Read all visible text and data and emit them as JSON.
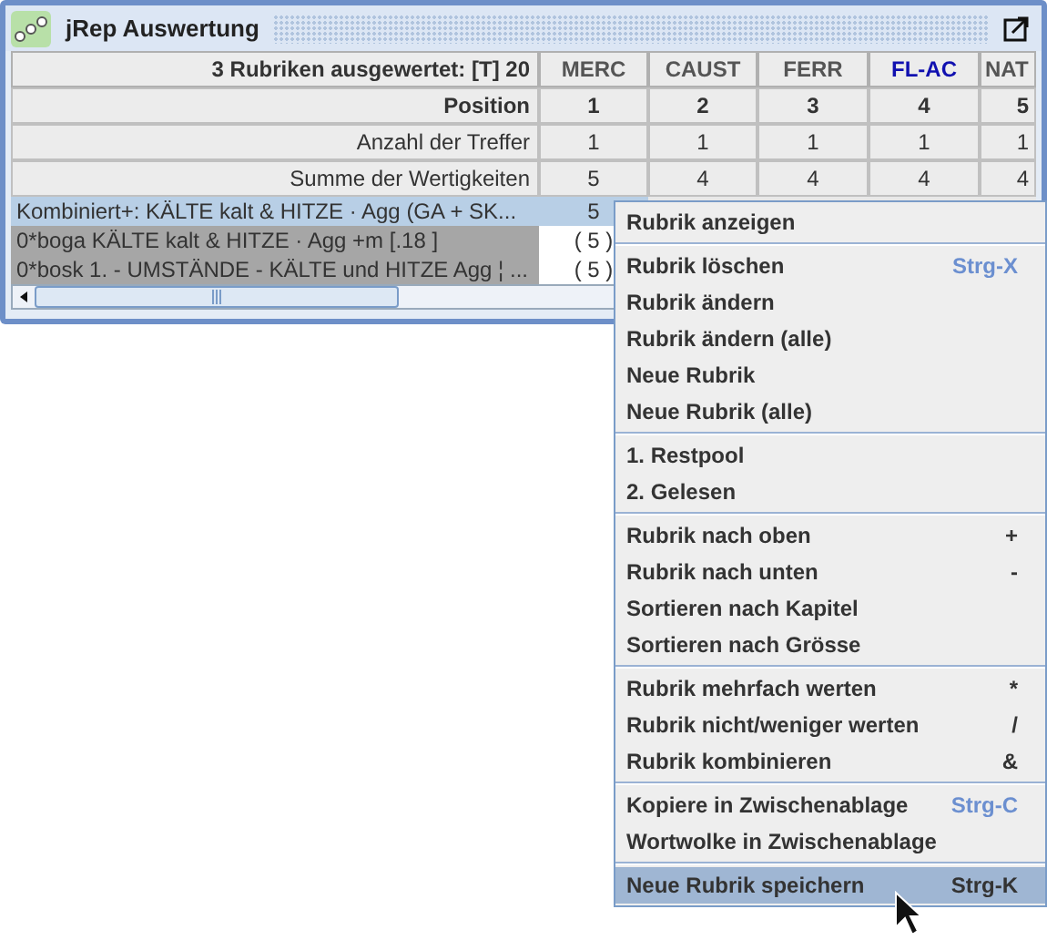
{
  "window": {
    "title": "jRep Auswertung"
  },
  "table": {
    "header": {
      "label": "3 Rubriken ausgewertet:  [T] 20",
      "columns": [
        {
          "name": "MERC",
          "color": "#555555"
        },
        {
          "name": "CAUST",
          "color": "#555555"
        },
        {
          "name": "FERR",
          "color": "#555555"
        },
        {
          "name": "FL-AC",
          "color": "#1010b0"
        },
        {
          "name": "NAT",
          "color": "#555555"
        }
      ]
    },
    "summary_rows": [
      {
        "kind": "bold",
        "label": "Position",
        "values": [
          "1",
          "2",
          "3",
          "4",
          "5"
        ]
      },
      {
        "kind": "plain",
        "label": "Anzahl der Treffer",
        "values": [
          "1",
          "1",
          "1",
          "1",
          "1"
        ]
      },
      {
        "kind": "plain",
        "label": "Summe der Wertigkeiten",
        "values": [
          "5",
          "4",
          "4",
          "4",
          "4"
        ]
      }
    ],
    "rubric_rows": [
      {
        "label": "Kombiniert+:  KÄLTE kalt & HITZE · Agg  (GA + SK...",
        "value": "5",
        "selected": true
      },
      {
        "label": "0*boga  KÄLTE kalt & HITZE · Agg  +m  [.18 ]",
        "value": "( 5 )",
        "selected": false
      },
      {
        "label": "0*bosk  1. - UMSTÄNDE - KÄLTE und HITZE Agg ¦ ...",
        "value": "( 5 )",
        "selected": false
      }
    ]
  },
  "context_menu": {
    "groups": [
      {
        "items": [
          {
            "label": "Rubrik anzeigen",
            "selected": false
          }
        ]
      },
      {
        "items": [
          {
            "label": "Rubrik löschen",
            "shortcut": "Strg-X",
            "color": "#6b8fd0",
            "selected": false
          },
          {
            "label": "Rubrik ändern",
            "selected": false
          },
          {
            "label": "Rubrik ändern (alle)",
            "selected": false
          },
          {
            "label": "Neue Rubrik",
            "selected": false
          },
          {
            "label": "Neue Rubrik (alle)",
            "selected": false
          }
        ]
      },
      {
        "items": [
          {
            "label": "1. Restpool",
            "selected": false
          },
          {
            "label": "2. Gelesen",
            "selected": false
          }
        ]
      },
      {
        "items": [
          {
            "label": "Rubrik nach oben",
            "shortcut": "+",
            "color": "#333333",
            "selected": false
          },
          {
            "label": "Rubrik nach unten",
            "shortcut": "-",
            "color": "#333333",
            "selected": false
          },
          {
            "label": "Sortieren nach Kapitel",
            "selected": false
          },
          {
            "label": "Sortieren nach Grösse",
            "selected": false
          }
        ]
      },
      {
        "items": [
          {
            "label": "Rubrik mehrfach werten",
            "shortcut": "*",
            "color": "#333333",
            "selected": false
          },
          {
            "label": "Rubrik nicht/weniger werten",
            "shortcut": "/",
            "color": "#333333",
            "selected": false
          },
          {
            "label": "Rubrik kombinieren",
            "shortcut": "&",
            "color": "#333333",
            "selected": false
          }
        ]
      },
      {
        "items": [
          {
            "label": "Kopiere in Zwischenablage",
            "shortcut": "Strg-C",
            "color": "#6b8fd0",
            "selected": false
          },
          {
            "label": "Wortwolke in Zwischenablage",
            "selected": false
          }
        ]
      },
      {
        "items": [
          {
            "label": "Neue Rubrik speichern",
            "shortcut": "Strg-K",
            "color": "#333333",
            "selected": true
          }
        ]
      }
    ]
  }
}
